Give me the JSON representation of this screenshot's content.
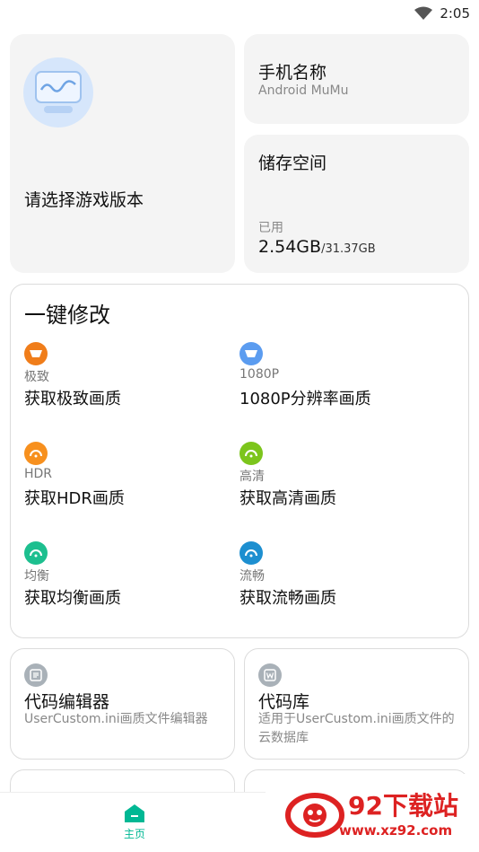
{
  "status_bar": {
    "time": "2:05"
  },
  "version_card": {
    "label": "请选择游戏版本"
  },
  "device_card": {
    "title": "手机名称",
    "value": "Android MuMu"
  },
  "storage_card": {
    "title": "储存空间",
    "used_label": "已用",
    "used": "2.54GB",
    "total": "/31.37GB"
  },
  "one_key": {
    "title": "一键修改",
    "options": [
      {
        "tag": "极致",
        "name": "获取极致画质",
        "color": "#f07d1a"
      },
      {
        "tag": "1080P",
        "name": "1080P分辨率画质",
        "color": "#5b9cf0"
      },
      {
        "tag": "HDR",
        "name": "获取HDR画质",
        "color": "#f7901e"
      },
      {
        "tag": "高清",
        "name": "获取高清画质",
        "color": "#7cc51c"
      },
      {
        "tag": "均衡",
        "name": "获取均衡画质",
        "color": "#1dbf8f"
      },
      {
        "tag": "流畅",
        "name": "获取流畅画质",
        "color": "#1d8fd0"
      }
    ]
  },
  "tools": [
    {
      "title": "代码编辑器",
      "desc": "UserCustom.ini画质文件编辑器"
    },
    {
      "title": "代码库",
      "desc": "适用于UserCustom.ini画质文件的云数据库"
    }
  ],
  "bottom_nav": {
    "home_label": "主页",
    "accent": "#00b894"
  },
  "watermark": {
    "title": "92下载站",
    "url": "www.xz92.com"
  }
}
